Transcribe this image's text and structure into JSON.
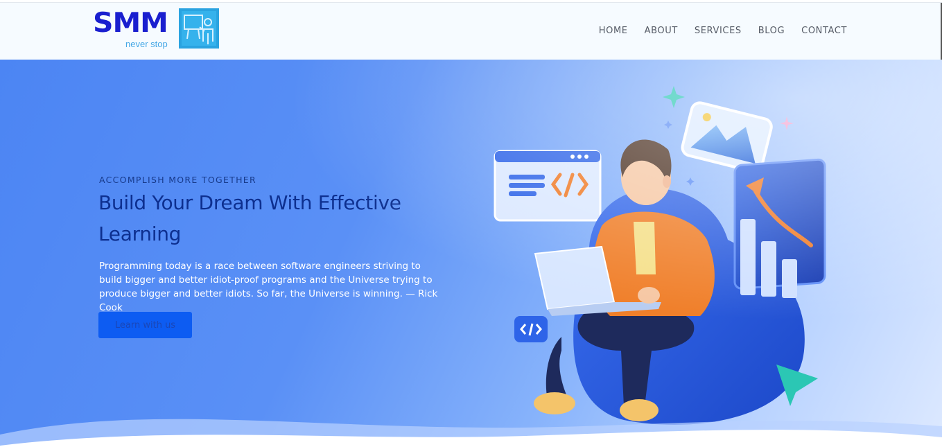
{
  "brand": {
    "name": "SMM",
    "tagline": "never stop",
    "primary_color": "#1a1fcf",
    "accent_color": "#46a8e6",
    "icon": "presentation-board-icon"
  },
  "nav": {
    "items": [
      {
        "label": "HOME"
      },
      {
        "label": "ABOUT"
      },
      {
        "label": "SERVICES"
      },
      {
        "label": "BLOG"
      },
      {
        "label": "CONTACT"
      }
    ]
  },
  "hero": {
    "eyebrow": "ACCOMPLISH MORE TOGETHER",
    "title": "Build Your Dream With Effective Learning",
    "quote": "Programming today is a race between software engineers striving to build bigger and better idiot-proof programs and the Universe trying to produce bigger and better idiots. So far, the Universe is winning. — Rick Cook",
    "cta_label": "Learn with us",
    "background_color": "#4c85f3",
    "cta_color": "#0d5cf2",
    "illustration": "person-with-laptop-illustration"
  }
}
